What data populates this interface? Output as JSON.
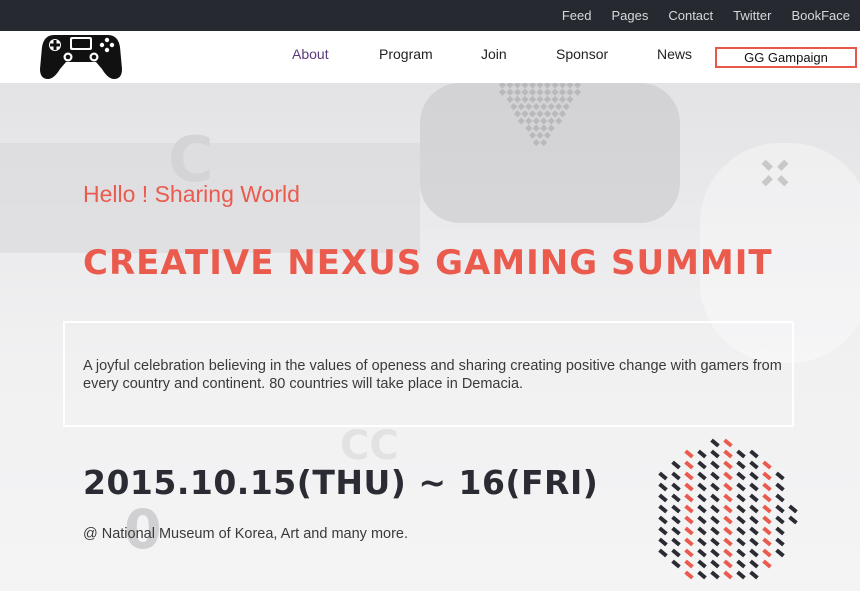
{
  "topbar": {
    "links": [
      "Feed",
      "Pages",
      "Contact",
      "Twitter",
      "BookFace"
    ]
  },
  "nav": {
    "items": [
      "About",
      "Program",
      "Join",
      "Sponsor",
      "News"
    ],
    "cta": "GG Gampaign"
  },
  "hero": {
    "tagline": "Hello ! Sharing World",
    "title": "CREATIVE NEXUS GAMING SUMMIT",
    "description": "A joyful celebration believing in the values of openess and sharing creating positive change with gamers from every country and continent. 80 countries will take place in Demacia.",
    "date": "2015.10.15(THU) ~ 16(FRI)",
    "venue": "@ National Museum of Korea, Art and many more."
  },
  "colors": {
    "accent": "#ea5b4e",
    "dark": "#262930",
    "text": "#3a3a3a"
  }
}
